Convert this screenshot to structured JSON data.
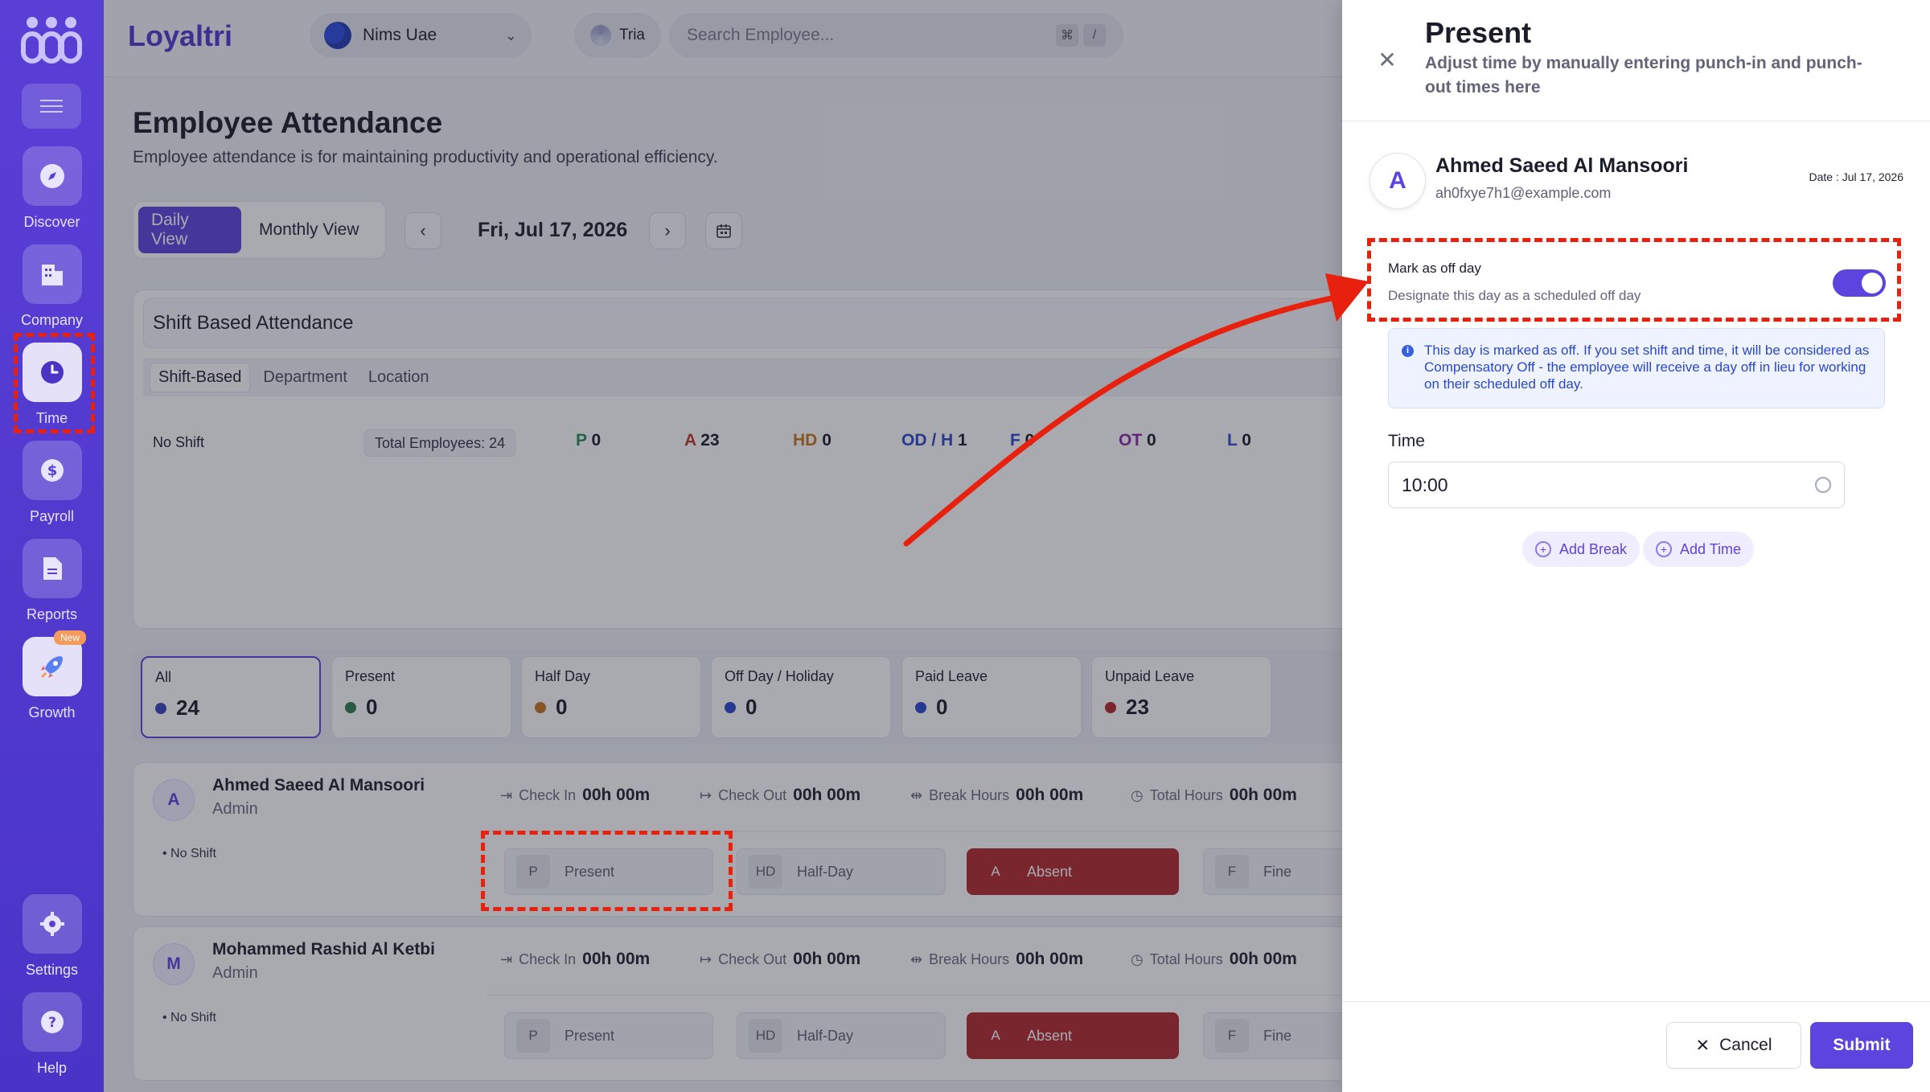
{
  "app": {
    "brand": "Loyaltri"
  },
  "sidebar": {
    "items": [
      {
        "label": "Discover",
        "icon": "compass-icon"
      },
      {
        "label": "Company",
        "icon": "building-icon"
      },
      {
        "label": "Time",
        "icon": "clock-icon"
      },
      {
        "label": "Payroll",
        "icon": "dollar-icon"
      },
      {
        "label": "Reports",
        "icon": "document-icon"
      },
      {
        "label": "Growth",
        "icon": "rocket-icon",
        "badge": "New"
      },
      {
        "label": "Settings",
        "icon": "gear-icon"
      },
      {
        "label": "Help",
        "icon": "help-icon"
      }
    ]
  },
  "topbar": {
    "company": "Nims Uae",
    "assistant": "Tria",
    "search_placeholder": "Search Employee...",
    "shortcut_key1": "⌘",
    "shortcut_key2": "/"
  },
  "main": {
    "title": "Employee Attendance",
    "subtitle": "Employee attendance is for maintaining productivity and operational efficiency.",
    "views": {
      "daily": "Daily View",
      "monthly": "Monthly View"
    },
    "date": "Fri, Jul 17, 2026",
    "shift_section": {
      "title": "Shift Based Attendance",
      "tabs": [
        "Shift-Based",
        "Department",
        "Location"
      ],
      "row_label": "No Shift",
      "total": "Total Employees: 24",
      "stats": [
        {
          "code": "P",
          "value": "0",
          "color": "#2e8b57"
        },
        {
          "code": "A",
          "value": "23",
          "color": "#c0392b"
        },
        {
          "code": "HD",
          "value": "0",
          "color": "#c9771f"
        },
        {
          "code": "OD / H",
          "value": "1",
          "color": "#2e49c9"
        },
        {
          "code": "F",
          "value": "0",
          "color": "#2e49c9"
        },
        {
          "code": "OT",
          "value": "0",
          "color": "#8e2ca8"
        },
        {
          "code": "L",
          "value": "0",
          "color": "#2e49c9"
        }
      ]
    },
    "filters": [
      {
        "label": "All",
        "count": "24",
        "color": "#3a44b8"
      },
      {
        "label": "Present",
        "count": "0",
        "color": "#2e7d4f"
      },
      {
        "label": "Half Day",
        "count": "0",
        "color": "#c9771f"
      },
      {
        "label": "Off Day / Holiday",
        "count": "0",
        "color": "#2e49c9"
      },
      {
        "label": "Paid Leave",
        "count": "0",
        "color": "#2e49c9"
      },
      {
        "label": "Unpaid Leave",
        "count": "23",
        "color": "#b42b30"
      }
    ],
    "employees": [
      {
        "initial": "A",
        "name": "Ahmed Saeed Al Mansoori",
        "role": "Admin",
        "shift": "No Shift",
        "check_in_label": "Check In",
        "check_in": "00h 00m",
        "check_out_label": "Check Out",
        "check_out": "00h 00m",
        "break_label": "Break Hours",
        "break": "00h 00m",
        "total_label": "Total Hours",
        "total": "00h 00m"
      },
      {
        "initial": "M",
        "name": "Mohammed Rashid Al Ketbi",
        "role": "Admin",
        "shift": "No Shift",
        "check_in_label": "Check In",
        "check_in": "00h 00m",
        "check_out_label": "Check Out",
        "check_out": "00h 00m",
        "break_label": "Break Hours",
        "break": "00h 00m",
        "total_label": "Total Hours",
        "total": "00h 00m"
      }
    ],
    "status_options": [
      {
        "code": "P",
        "label": "Present"
      },
      {
        "code": "HD",
        "label": "Half-Day"
      },
      {
        "code": "A",
        "label": "Absent"
      },
      {
        "code": "F",
        "label": "Fine"
      }
    ]
  },
  "drawer": {
    "title": "Present",
    "subtitle": "Adjust time by manually entering punch-in and punch-out times here",
    "employee_initial": "A",
    "employee_name": "Ahmed Saeed Al Mansoori",
    "employee_email": "ah0fxye7h1@example.com",
    "date": "Date : Jul 17, 2026",
    "offday_title": "Mark as off day",
    "offday_sub": "Designate this day as a scheduled off day",
    "offday_enabled": true,
    "info": "This day is marked as off. If you set shift and time, it will be considered as Compensatory Off - the employee will receive a day off in lieu for working on their scheduled off day.",
    "time_label": "Time",
    "time_value": "10:00",
    "add_break": "Add Break",
    "add_time": "Add Time",
    "cancel": "Cancel",
    "submit": "Submit"
  }
}
